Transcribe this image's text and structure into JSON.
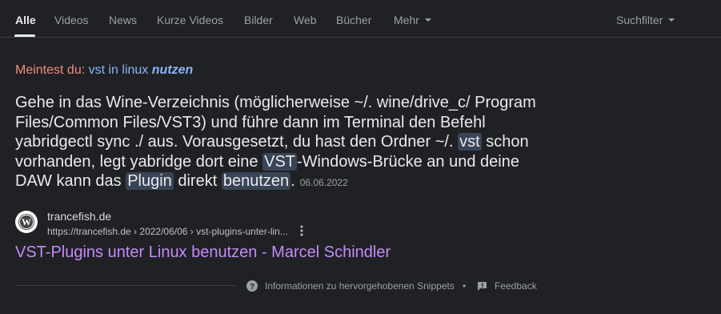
{
  "tabs": [
    {
      "label": "Alle",
      "active": true
    },
    {
      "label": "Videos"
    },
    {
      "label": "News"
    },
    {
      "label": "Kurze Videos"
    },
    {
      "label": "Bilder"
    },
    {
      "label": "Web"
    },
    {
      "label": "Bücher"
    },
    {
      "label": "Mehr"
    }
  ],
  "search_filter_label": "Suchfilter",
  "did_you_mean": {
    "prefix": "Meintest du:",
    "query_plain": "vst in linux",
    "query_bold": "nutzen"
  },
  "snippet": {
    "text_1": "Gehe in das Wine-Verzeichnis (möglicherweise ~/. wine/drive_c/ Program Files/Common Files/VST3) und führe dann im Terminal den Befehl yabridgectl sync ./ aus. Vorausgesetzt, du hast den Ordner ~/. ",
    "hl_1": "vst",
    "text_2": " schon vorhanden, legt yabridge dort eine ",
    "hl_2": "VST",
    "text_3": "-Windows-Brücke an und deine DAW kann das ",
    "hl_3": "Plugin",
    "text_4": " direkt ",
    "hl_4": "benutzen",
    "text_5": ".",
    "date": "06.06.2022"
  },
  "result": {
    "site_name": "trancefish.de",
    "url": "https://trancefish.de › 2022/06/06 › vst-plugins-unter-lin...",
    "title": "VST-Plugins unter Linux benutzen - Marcel Schindler",
    "favicon": "wordpress-icon"
  },
  "footer": {
    "snippets_info": "Informationen zu hervorgehobenen Snippets",
    "bullet": "•",
    "feedback": "Feedback"
  },
  "colors": {
    "background": "#202124",
    "link_visited": "#c58af9",
    "link": "#8ab4f8",
    "did_you_mean": "#f28b82",
    "highlight": "#394457"
  }
}
